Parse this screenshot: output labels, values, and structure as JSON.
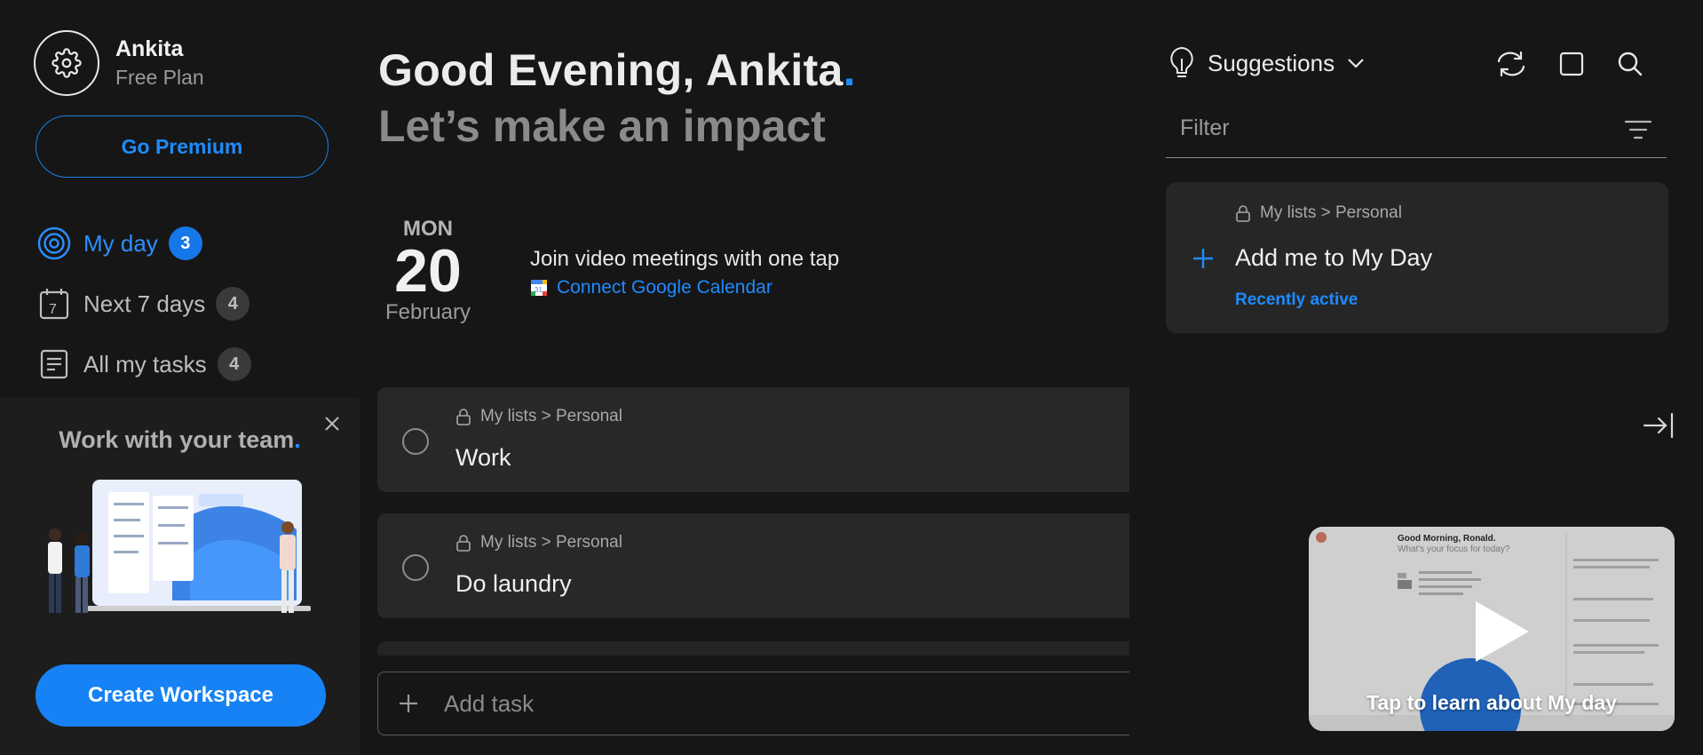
{
  "profile": {
    "name": "Ankita",
    "plan": "Free Plan"
  },
  "sidebar": {
    "premium_label": "Go Premium",
    "nav": [
      {
        "label": "My day",
        "count": "3",
        "icon": "target-icon",
        "active": true
      },
      {
        "label": "Next 7 days",
        "count": "4",
        "icon": "calendar-7-icon",
        "active": false
      },
      {
        "label": "All my tasks",
        "count": "4",
        "icon": "list-icon",
        "active": false
      }
    ],
    "team": {
      "title": "Work with your team",
      "dot": ".",
      "create_label": "Create Workspace"
    }
  },
  "main": {
    "greeting": "Good Evening, Ankita",
    "greeting_dot": ".",
    "subgreeting": "Let’s make an impact",
    "date": {
      "dow": "MON",
      "day": "20",
      "month": "February"
    },
    "meeting": {
      "title": "Join video meetings with one tap",
      "link": "Connect Google Calendar"
    },
    "tasks": [
      {
        "path": "My lists > Personal",
        "title": "Work"
      },
      {
        "path": "My lists > Personal",
        "title": "Do laundry"
      }
    ],
    "add_task_placeholder": "Add task"
  },
  "right": {
    "suggestions_label": "Suggestions",
    "filter_placeholder": "Filter",
    "suggestion": {
      "path": "My lists > Personal",
      "title": "Add me to My Day",
      "meta": "Recently active"
    },
    "video": {
      "caption": "Tap to learn about My day",
      "mock_title": "Good Morning, Ronald.",
      "mock_sub": "What's your focus for today?"
    }
  },
  "colors": {
    "accent": "#1e8bff",
    "background": "#161616",
    "card": "#282828"
  }
}
